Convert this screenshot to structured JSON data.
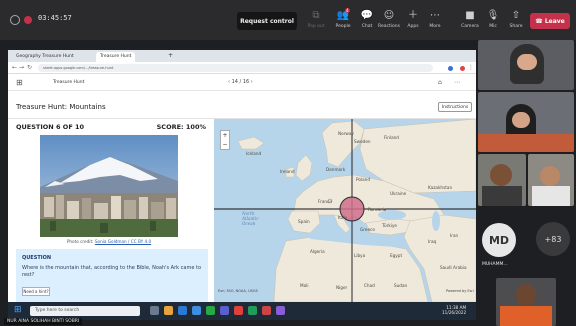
{
  "meeting": {
    "timer": "03:45:57",
    "request_control": "Request control",
    "buttons": [
      {
        "label": "Pop out",
        "icon": "popout-icon",
        "glyph": "⧉",
        "dim": true
      },
      {
        "label": "People",
        "icon": "people-icon",
        "glyph": "👥",
        "badge": "4"
      },
      {
        "label": "Chat",
        "icon": "chat-icon",
        "glyph": "💬"
      },
      {
        "label": "Reactions",
        "icon": "reactions-icon",
        "glyph": "☺"
      },
      {
        "label": "Apps",
        "icon": "apps-icon",
        "glyph": "＋"
      },
      {
        "label": "More",
        "icon": "more-icon",
        "glyph": "⋯"
      },
      {
        "label": "Camera",
        "icon": "camera-icon",
        "glyph": "■"
      },
      {
        "label": "Mic",
        "icon": "mic-icon",
        "glyph": "🎙"
      },
      {
        "label": "Share",
        "icon": "share-icon",
        "glyph": "⇧"
      }
    ],
    "leave": "Leave",
    "presenter": "NUR AINA SOLIHAH BINTI SOBRI"
  },
  "browser": {
    "tabs": [
      "Geography Treasure Hunt",
      "Treasure Hunt"
    ],
    "url": "sheet.apps.google.com/.../treasure-hunt"
  },
  "app": {
    "header_title": "Treasure Hunt",
    "pager": "14 / 16",
    "page_title": "Treasure Hunt: Mountains",
    "instructions": "Instructions",
    "question_num": "QUESTION 6 OF 10",
    "score": "SCORE: 100%",
    "credit_prefix": "Photo credit: ",
    "credit_link": "Sonia Goldman / CC BY 4.0",
    "question_label": "QUESTION",
    "question_text": "Where is the mountain that, according to the Bible, Noah's Ark came to rest?",
    "hint": "Need a hint?"
  },
  "map": {
    "labels": [
      "Iceland",
      "Norway",
      "Sweden",
      "Finland",
      "Ireland",
      "Denmark",
      "Poland",
      "Ukraine",
      "Kazakhstan",
      "France",
      "Spain",
      "Italy",
      "Romania",
      "Türkiye",
      "Iran",
      "Algeria",
      "Libya",
      "Egypt",
      "Saudi Arabia",
      "Mali",
      "Niger",
      "Chad",
      "Sudan",
      "Iraq",
      "Greece"
    ],
    "seas": [
      "North Atlantic Ocean"
    ],
    "attribution": "Esri, FAO, NOAA, USGS",
    "powered": "Powered by Esri"
  },
  "taskbar": {
    "search": "Type here to search",
    "time": "11:38 AM",
    "date": "11/26/2022"
  },
  "participants": {
    "tile_initials": "MD",
    "tile_name": "MUHAMM...",
    "more": "+83"
  }
}
